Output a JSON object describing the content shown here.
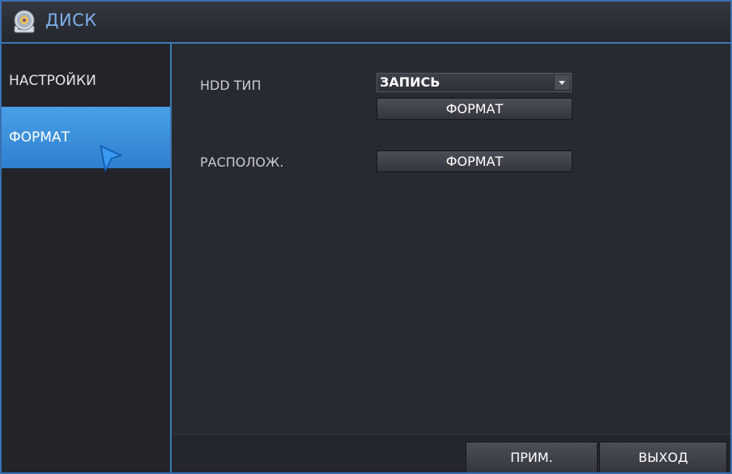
{
  "window": {
    "title": "ДИСК",
    "title_icon": "disk-icon"
  },
  "sidebar": {
    "items": [
      {
        "label": "НАСТРОЙКИ",
        "selected": false
      },
      {
        "label": "ФОРМАТ",
        "selected": true
      }
    ]
  },
  "main": {
    "hdd_type_label": "HDD ТИП",
    "hdd_type_value": "ЗАПИСЬ",
    "format_button_1": "ФОРМАТ",
    "location_label": "РАСПОЛОЖ.",
    "format_button_2": "ФОРМАТ"
  },
  "footer": {
    "apply_label": "ПРИМ.",
    "exit_label": "ВЫХОД"
  },
  "colors": {
    "accent": "#3f78b8",
    "selected_item": "#3a8fdc",
    "title_text": "#7fb0ec",
    "background": "#272a30"
  }
}
